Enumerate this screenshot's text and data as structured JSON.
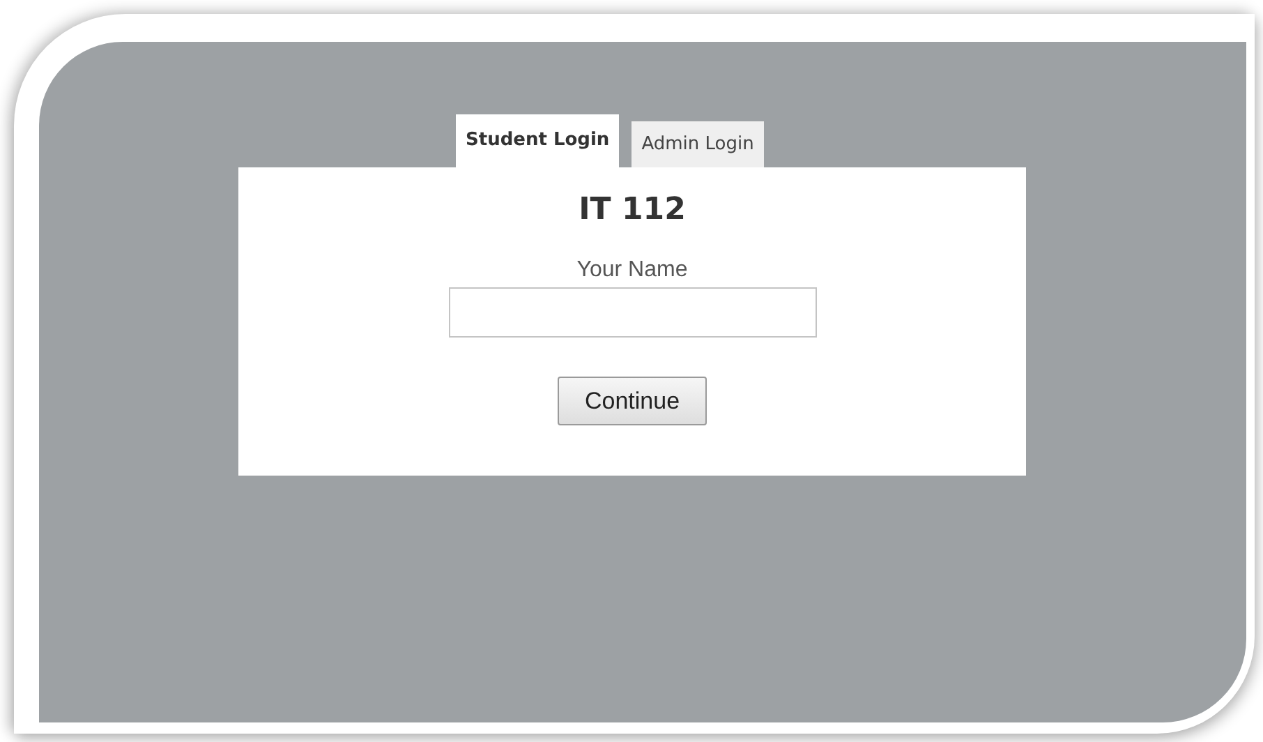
{
  "tabs": [
    {
      "label": "Student Login",
      "selected": true
    },
    {
      "label": "Admin Login",
      "selected": false
    }
  ],
  "title": "IT 112",
  "name_field": {
    "label": "Your Name"
  },
  "button": "Continue"
}
